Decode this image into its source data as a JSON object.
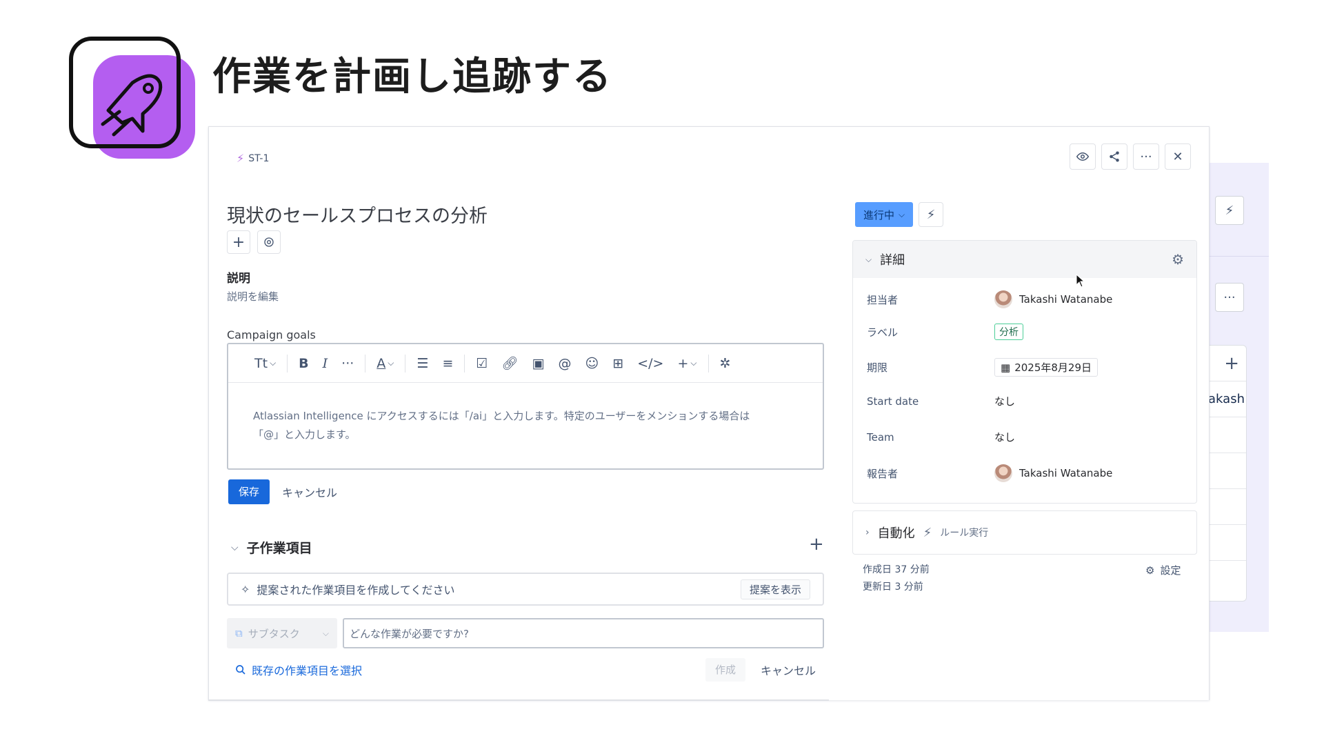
{
  "slide": {
    "title": "作業を計画し追跡する"
  },
  "issue": {
    "key": "ST-1",
    "title": "現状のセールスプロセスの分析",
    "description_label": "説明",
    "description_edit": "説明を編集",
    "field_label": "Campaign goals",
    "editor_toolbar_text_style": "Tt",
    "editor_placeholder_line1": "Atlassian Intelligence にアクセスするには「/ai」と入力します。特定のユーザーをメンションする場合は",
    "editor_placeholder_line2": "「@」と入力します。",
    "save_label": "保存",
    "cancel_label": "キャンセル"
  },
  "child_items": {
    "heading": "子作業項目",
    "suggest_text": "提案された作業項目を作成してください",
    "suggest_button": "提案を表示",
    "subtask_type": "サブタスク",
    "input_placeholder": "どんな作業が必要ですか?",
    "existing_link": "既存の作業項目を選択",
    "create_label": "作成",
    "cancel_label": "キャンセル"
  },
  "status": {
    "label": "進行中",
    "color": "#579dff"
  },
  "details": {
    "heading": "詳細",
    "rows": [
      {
        "label": "担当者",
        "value": "Takashi Watanabe"
      },
      {
        "label": "ラベル",
        "value": "分析"
      },
      {
        "label": "期限",
        "value": "2025年8月29日"
      },
      {
        "label": "Start date",
        "value": "なし"
      },
      {
        "label": "Team",
        "value": "なし"
      },
      {
        "label": "報告者",
        "value": "Takashi Watanabe"
      }
    ]
  },
  "automation": {
    "heading": "自動化",
    "rule_label": "ルール実行"
  },
  "meta": {
    "created": "作成日 37 分前",
    "updated": "更新日 3 分前",
    "settings_label": "設定"
  },
  "background": {
    "partial_name": "akash"
  },
  "colors": {
    "accent": "#1868db",
    "logo_purple": "#b45ef0"
  }
}
